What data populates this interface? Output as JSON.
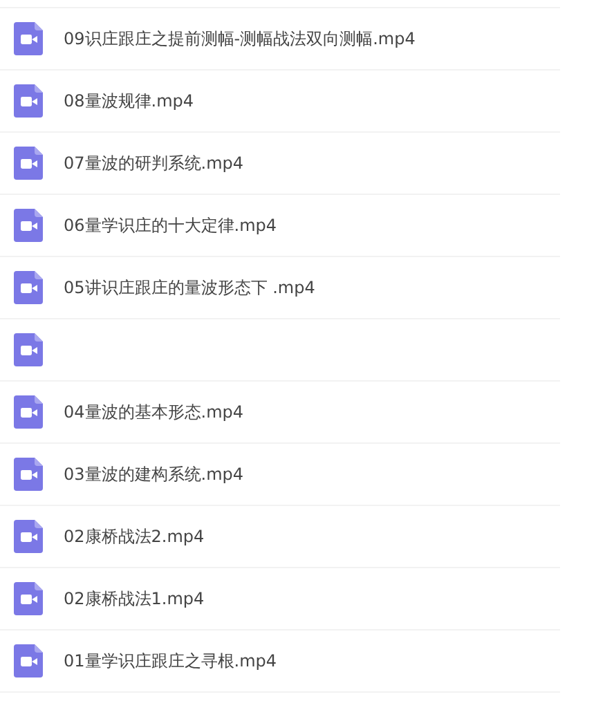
{
  "files": [
    {
      "kind": "file",
      "name": "09识庄跟庄之提前测幅-测幅战法双向测幅.mp4"
    },
    {
      "kind": "file",
      "name": "08量波规律.mp4"
    },
    {
      "kind": "file",
      "name": "07量波的研判系统.mp4"
    },
    {
      "kind": "file",
      "name": "06量学识庄的十大定律.mp4"
    },
    {
      "kind": "file",
      "name": "05讲识庄跟庄的量波形态下 .mp4"
    },
    {
      "kind": "covered"
    },
    {
      "kind": "file",
      "name": "04量波的基本形态.mp4"
    },
    {
      "kind": "file",
      "name": "03量波的建构系统.mp4"
    },
    {
      "kind": "file",
      "name": "02康桥战法2.mp4"
    },
    {
      "kind": "file",
      "name": "02康桥战法1.mp4"
    },
    {
      "kind": "file",
      "name": "01量学识庄跟庄之寻根.mp4"
    }
  ]
}
